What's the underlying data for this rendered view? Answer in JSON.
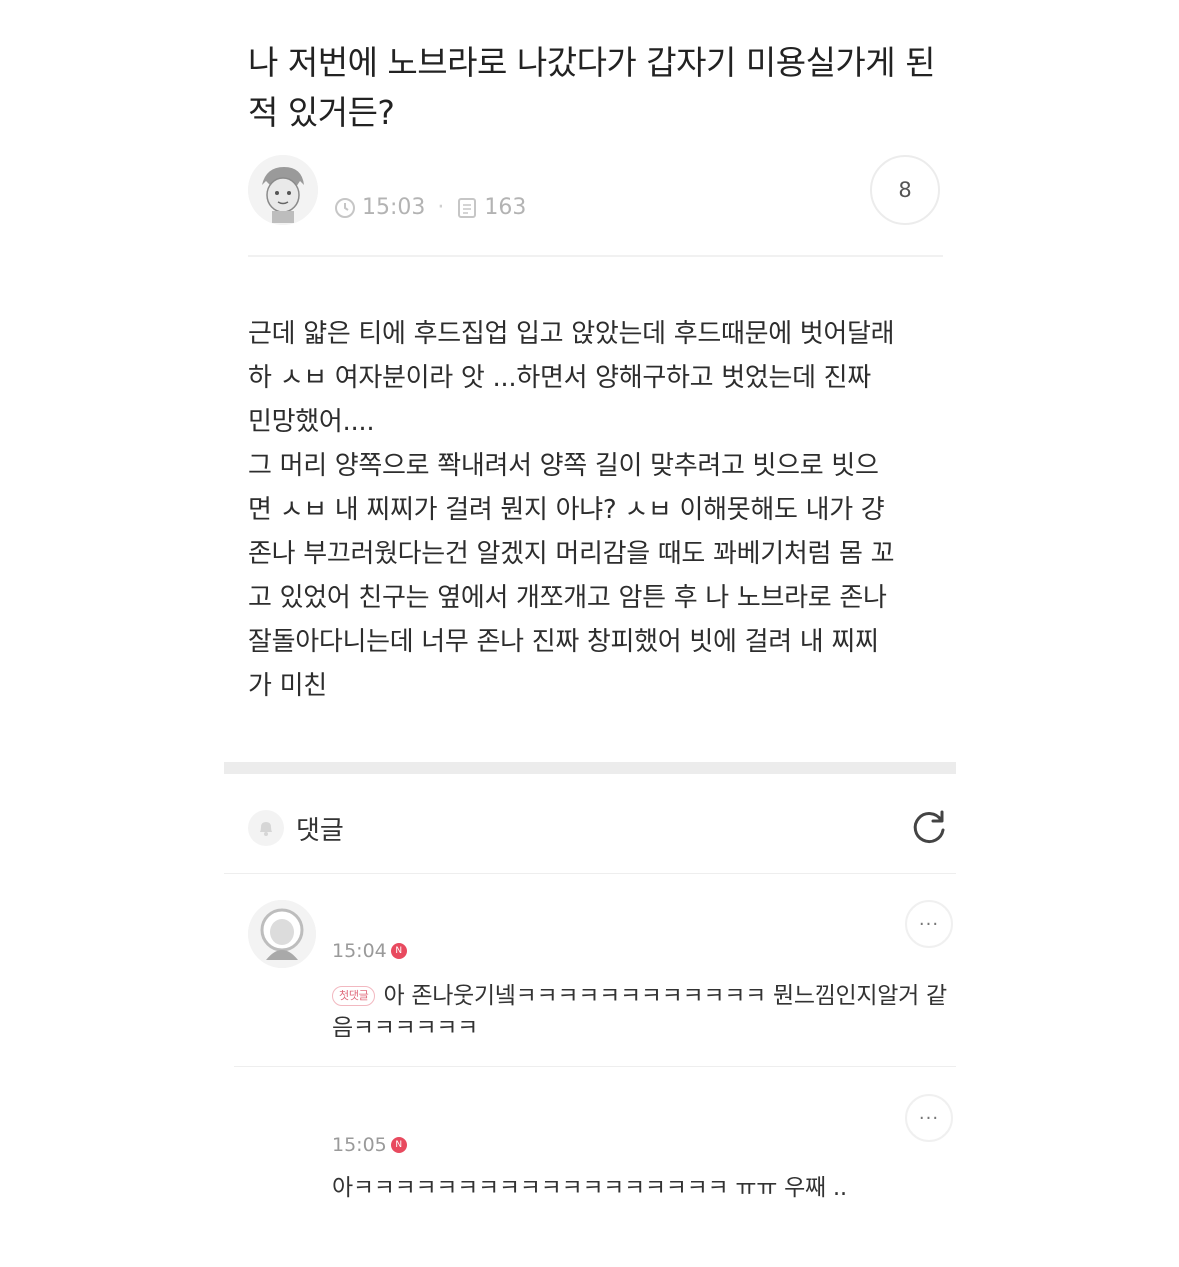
{
  "post": {
    "title": "나 저번에 노브라로 나갔다가 갑자기 미용실가게 된적 있거든?",
    "time": "15:03",
    "views": "163",
    "comment_count": "8",
    "body": "근데 얇은 티에 후드집업 입고 앉았는데 후드때문에 벗어달래\n하 ㅅㅂ 여자분이라 앗 ...하면서 양해구하고 벗었는데 진짜\n민망했어....\n그 머리 양쪽으로 쫙내려서 양쪽 길이 맞추려고 빗으로 빗으\n면 ㅅㅂ 내 찌찌가 걸려 뭔지 아냐? ㅅㅂ 이해못해도 내가 걍\n존나 부끄러웠다는건 알겠지 머리감을 때도 꽈베기처럼 몸 꼬\n고 있었어 친구는 옆에서 개쪼개고 암튼 후 나 노브라로 존나\n잘돌아다니는데 너무 존나 진짜 창피했어 빗에 걸려 내 찌찌\n가 미친"
  },
  "comments_section": {
    "label": "댓글"
  },
  "comments": [
    {
      "time": "15:04",
      "badge": "N",
      "author_tag": "첫댓글",
      "text": "아 존나웃기넼ㅋㅋㅋㅋㅋㅋㅋㅋㅋㅋㅋㅋ 뭔느낌인지알거 같음ㅋㅋㅋㅋㅋㅋ",
      "more": "···"
    },
    {
      "time": "15:05",
      "badge": "N",
      "text": "아ㅋㅋㅋㅋㅋㅋㅋㅋㅋㅋㅋㅋㅋㅋㅋㅋㅋㅋ ㅠㅠ 우째 ..",
      "more": "···"
    }
  ],
  "icons": {
    "clock": "clock-icon",
    "views": "views-icon",
    "bell": "bell-icon",
    "refresh": "refresh-icon",
    "more": "more-icon"
  },
  "colors": {
    "badge": "#e84a5f",
    "meta": "#b3b3b3",
    "text": "#2d2d2d"
  }
}
